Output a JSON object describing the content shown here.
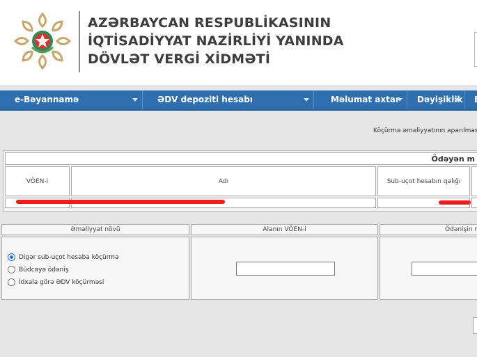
{
  "header": {
    "title_lines": [
      "AZƏRBAYCAN RESPUBLİKASININ",
      "İQTİSADİYYAT NAZİRLİYİ YANINDA",
      "DÖVLƏT VERGİ XİDMƏTİ"
    ],
    "emblem_icon": "state-emblem-icon"
  },
  "nav": {
    "items": [
      {
        "label": "e-Bəyannamə"
      },
      {
        "label": "ƏDV depoziti hesabı"
      },
      {
        "label": "Məlumat axtar"
      },
      {
        "label": "Dəyişiklik"
      },
      {
        "label": "E"
      }
    ]
  },
  "content": {
    "info_text": "Köçürmə əməliyyatının aparılması",
    "payer_table": {
      "header": "Ödəyən m",
      "columns": [
        "VÖEN-i",
        "Adı",
        "Sub-uçot hesabın qalığı"
      ]
    },
    "operation_table": {
      "columns": [
        "Əməliyyat növü",
        "Alanın VÖEN-i",
        "Ödənişin n"
      ],
      "options": [
        {
          "label": "Digər sub-uçot hesaba köçürmə",
          "checked": true
        },
        {
          "label": "Büdcəyə ödəniş",
          "checked": false
        },
        {
          "label": "İdxala görə ƏDV köçürməsi",
          "checked": false
        }
      ]
    }
  },
  "colors": {
    "nav_bg": "#2f6fb0",
    "page_bg": "#e6e6e6",
    "redaction": "#ee1c1c",
    "emblem_gold": "#c9a66b"
  }
}
